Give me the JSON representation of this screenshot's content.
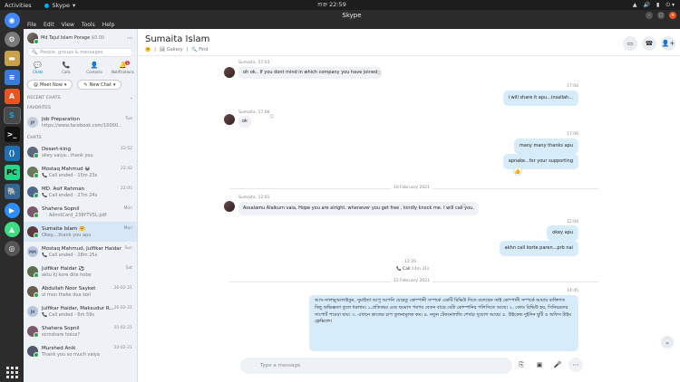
{
  "topbar": {
    "activities": "Activities",
    "app_name": "Skype",
    "clock": "শুক্র 22:59"
  },
  "dock": {
    "apps": [
      "Chromium",
      "Settings",
      "Files",
      "Docs",
      "Software",
      "Skype",
      "Terminal",
      "VS Code",
      "PyCharm",
      "Postgres",
      "Zoom",
      "Android Studio",
      "Assist"
    ]
  },
  "window": {
    "title": "Skype",
    "menu": [
      "File",
      "Edit",
      "View",
      "Tools",
      "Help"
    ]
  },
  "profile": {
    "name": "Md Tajul Islam Porage",
    "balance": "$0.00"
  },
  "search": {
    "placeholder": "People, groups & messages"
  },
  "tabs": [
    {
      "label": "Chats",
      "icon": "💬"
    },
    {
      "label": "Calls",
      "icon": "📞"
    },
    {
      "label": "Contacts",
      "icon": "👤"
    },
    {
      "label": "Notifications",
      "icon": "🔔",
      "badge": "1"
    }
  ],
  "buttons": {
    "meet_now": "Meet Now",
    "new_chat": "New Chat"
  },
  "sections": {
    "recent": "RECENT CHATS",
    "favorites": "FAVORITES",
    "chats": "CHATS"
  },
  "favorites": [
    {
      "name": "Job Preparation",
      "preview": "https://www.facebook.com/10000...",
      "time": "Tue"
    }
  ],
  "chats": [
    {
      "name": "Desert-king",
      "preview": "okey vaiya...thank you",
      "time": "22:52",
      "color": "#5a6b7d"
    },
    {
      "name": "Mostaq Mahmud 😀",
      "preview": "📞 Call ended - 15m 23s",
      "time": "22:42",
      "color": "#6a7a5a"
    },
    {
      "name": "MD. Asif Rahman",
      "preview": "📞 Call ended - 27m 24s",
      "time": "22:05",
      "color": "#4d6a8a"
    },
    {
      "name": "Shahera Sopnil",
      "preview": "📄 AdmitCard_239YTV5L.pdf",
      "time": "Mon",
      "color": "#7a5a6a"
    },
    {
      "name": "Sumaita Islam 🤗",
      "preview": "Okey....thank you apu",
      "time": "Mon",
      "color": "#5c3b3b",
      "active": true
    },
    {
      "name": "Mostaq Mahmud, Julfikar Haidar",
      "preview": "📞 Call ended - 28m 25s",
      "time": "Sun",
      "color": "#b8c7dc",
      "initials": "MM"
    },
    {
      "name": "Julfikar Haidar ⚽",
      "preview": "aktu kj kore dite hobe",
      "time": "Sat",
      "color": "#5b6f4f"
    },
    {
      "name": "Abdullah Noor Sayket",
      "preview": "vi mon theke dua kori",
      "time": "26-02-21",
      "color": "#6a5b4a"
    },
    {
      "name": "Julfikar Haidar, Maksudur R...",
      "preview": "📞 Call ended - 6m 59s",
      "time": "26-02-21",
      "color": "#b8c7dc",
      "initials": "JH"
    },
    {
      "name": "Shahera Sopnil",
      "preview": "scrnshare hoice?",
      "time": "25-02-21",
      "color": "#7a5a6a"
    },
    {
      "name": "Murshed Anik",
      "preview": "Thank you so much vaiya",
      "time": "24-02-21",
      "color": "#4e5a6b"
    }
  ],
  "chat": {
    "title": "Sumaita Islam",
    "gallery": "Gallery",
    "find": "Find",
    "messages": {
      "m1_meta": "Sumaita, 17:03",
      "m1": "oh ok.. If you dont mind in which company you have joined",
      "m2_meta": "17:04",
      "m2": "i will share it apu...insallah...",
      "m3_meta": "Sumaita, 17:06",
      "m3": "ok",
      "m4_meta": "17:06",
      "m4a": "many many thanks apu",
      "m4b": "apnake...for your supporting",
      "date1": "10 February 2021",
      "m5_meta": "Sumaita, 12:01",
      "m5": "Assalamu Alaikum vaia, Hope you are alright. whenever you get free , kindly knock me. I will call you.",
      "m6_meta": "12:04",
      "m6a": "okey apu",
      "m6b": "akhn call korte paren...prb nai",
      "call_time": "12:20",
      "call_label": "Call",
      "call_dur": "14m 31s",
      "date2": "12 February 2021",
      "m7_meta": "14:45",
      "m7": "আস-সালামুআলাইকুম, সুমাইতা আপু আপনি যেহেতু কোম্পানী সম্পর্কে একটি রিভিউ দিতে বলেছেন তাই কোম্পানী সম্পর্কে আমার ব্যক্তিগত কিছু অভিজ্ঞতা তুলে ধরলাম। ১.প্রতিবছর এবং ছয়মাস পরপর বেতন বাড়ে যেটা কোম্পানির পলিসিতে আছে। ২. কোড রিভিউ হয়, সিনিয়রদের সাপোর্ট পাওয়া যায়। ৩. এখানে কাজের চাপ তুলনামূলক কম। ৪. নতুন টেকনোলজি শেখার সুযোগ আছে। ৫. উইকেন্ড দুইদিন ছুটি ও অফিস টাইম ফ্লেক্সিবল।"
    },
    "compose_placeholder": "Type a message"
  }
}
